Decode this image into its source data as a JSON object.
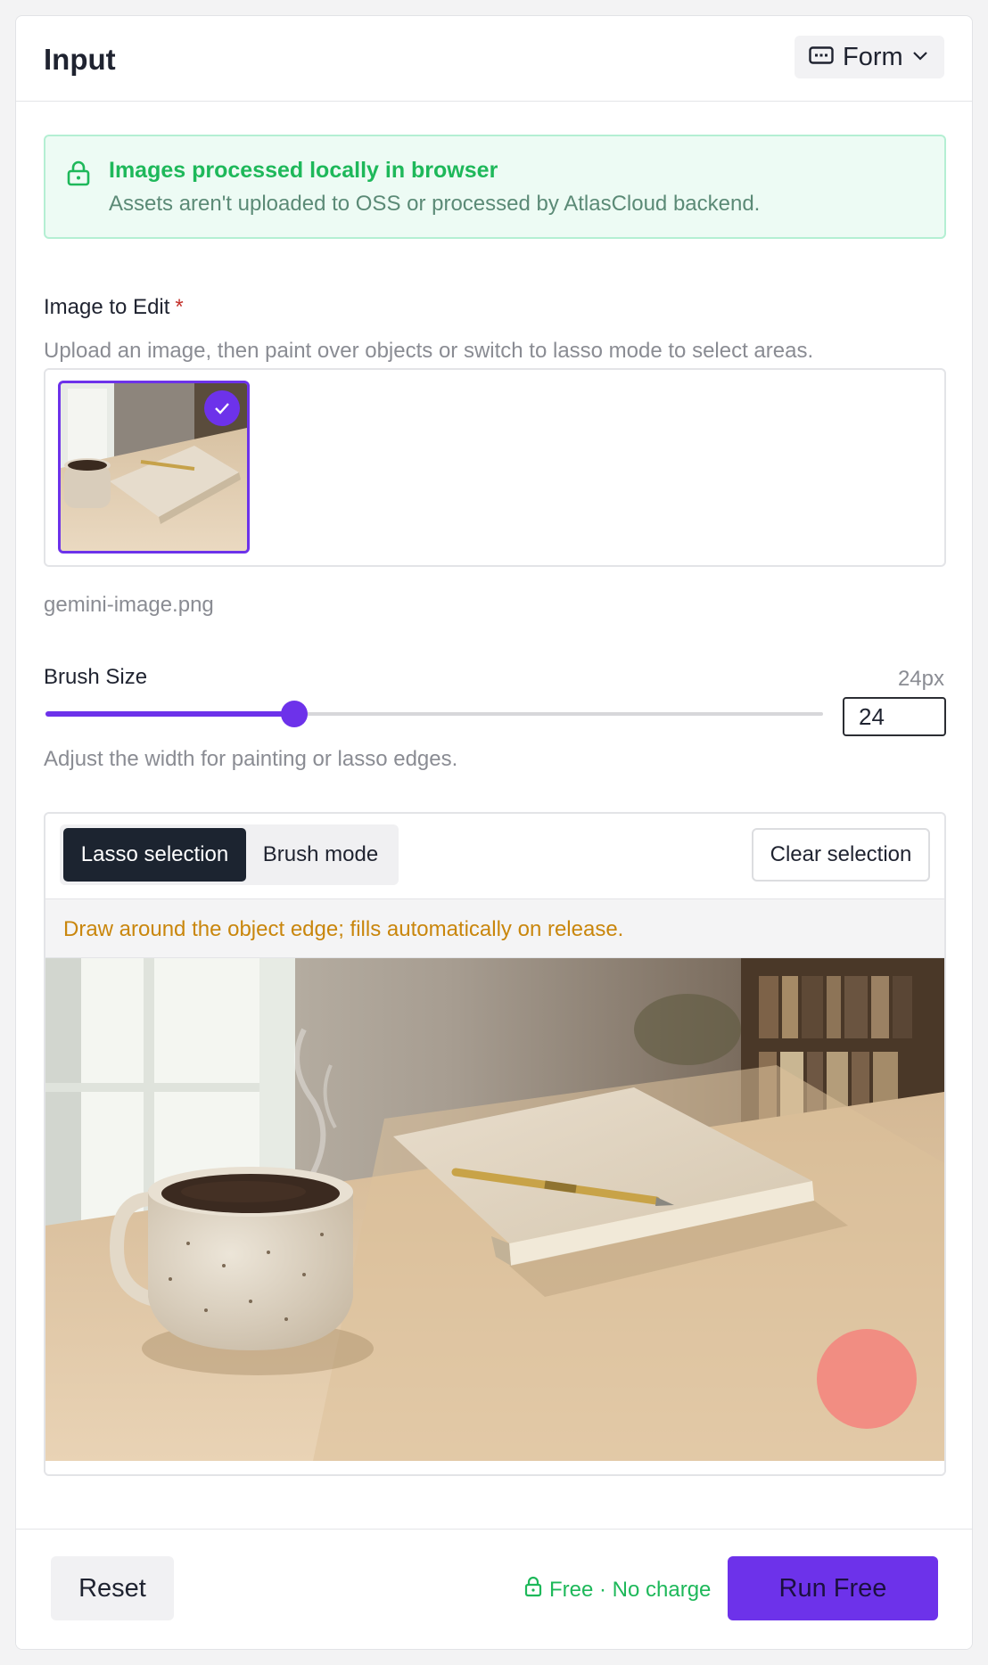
{
  "header": {
    "title": "Input",
    "view_button": {
      "icon": "keyboard-icon",
      "label": "Form",
      "chevron": "chevron-down-icon"
    }
  },
  "notice": {
    "icon": "lock-icon",
    "title": "Images processed locally in browser",
    "text": "Assets aren't uploaded to OSS or processed by AtlasCloud backend."
  },
  "image_field": {
    "label": "Image to Edit",
    "required_mark": "*",
    "help": "Upload an image, then paint over objects or switch to lasso mode to select areas.",
    "file_name": "gemini-image.png"
  },
  "brush": {
    "label": "Brush Size",
    "value_display": "24px",
    "value": "24",
    "slider_fraction": 0.32,
    "help": "Adjust the width for painting or lasso edges."
  },
  "editor": {
    "modes": [
      "Lasso selection",
      "Brush mode"
    ],
    "active_mode": "Lasso selection",
    "clear_label": "Clear selection",
    "hint": "Draw around the object edge; fills automatically on release."
  },
  "footer": {
    "reset_label": "Reset",
    "free_label": "Free · No charge",
    "run_label": "Run Free"
  },
  "colors": {
    "accent": "#6d32ea",
    "success": "#1eb85a",
    "warning_text": "#c9860c",
    "dark_segment": "#1c2430",
    "cursor_overlay": "#f4837d"
  }
}
